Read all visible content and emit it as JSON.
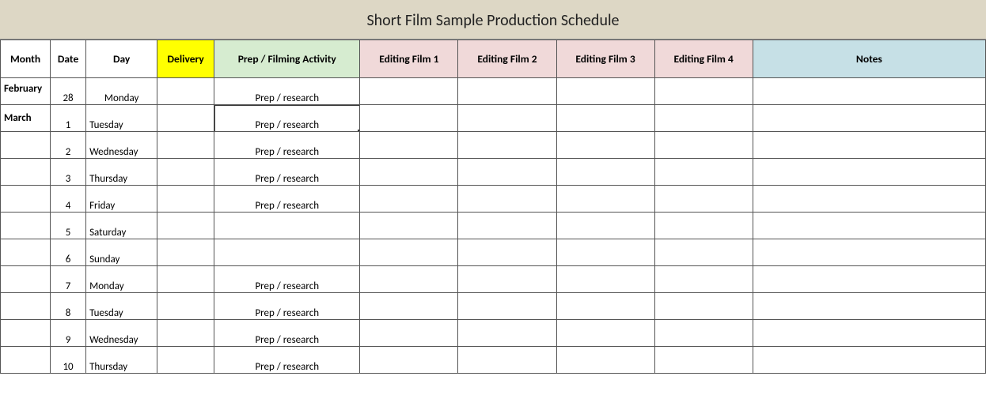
{
  "title": "Short Film Sample Production Schedule",
  "headers": {
    "month": "Month",
    "date": "Date",
    "day": "Day",
    "delivery": "Delivery",
    "activity": "Prep / Filming Activity",
    "edit1": "Editing Film 1",
    "edit2": "Editing Film 2",
    "edit3": "Editing Film 3",
    "edit4": "Editing Film 4",
    "notes": "Notes"
  },
  "rows": [
    {
      "month": "February",
      "date": "28",
      "day": "Monday",
      "delivery": "",
      "activity": "Prep / research",
      "e1": "",
      "e2": "",
      "e3": "",
      "e4": "",
      "notes": ""
    },
    {
      "month": "March",
      "date": "1",
      "day": "Tuesday",
      "delivery": "",
      "activity": "Prep / research",
      "e1": "",
      "e2": "",
      "e3": "",
      "e4": "",
      "notes": ""
    },
    {
      "month": "",
      "date": "2",
      "day": "Wednesday",
      "delivery": "",
      "activity": "Prep / research",
      "e1": "",
      "e2": "",
      "e3": "",
      "e4": "",
      "notes": ""
    },
    {
      "month": "",
      "date": "3",
      "day": "Thursday",
      "delivery": "",
      "activity": "Prep / research",
      "e1": "",
      "e2": "",
      "e3": "",
      "e4": "",
      "notes": ""
    },
    {
      "month": "",
      "date": "4",
      "day": "Friday",
      "delivery": "",
      "activity": "Prep / research",
      "e1": "",
      "e2": "",
      "e3": "",
      "e4": "",
      "notes": ""
    },
    {
      "month": "",
      "date": "5",
      "day": "Saturday",
      "delivery": "",
      "activity": "",
      "e1": "",
      "e2": "",
      "e3": "",
      "e4": "",
      "notes": ""
    },
    {
      "month": "",
      "date": "6",
      "day": "Sunday",
      "delivery": "",
      "activity": "",
      "e1": "",
      "e2": "",
      "e3": "",
      "e4": "",
      "notes": ""
    },
    {
      "month": "",
      "date": "7",
      "day": "Monday",
      "delivery": "",
      "activity": "Prep / research",
      "e1": "",
      "e2": "",
      "e3": "",
      "e4": "",
      "notes": ""
    },
    {
      "month": "",
      "date": "8",
      "day": "Tuesday",
      "delivery": "",
      "activity": "Prep / research",
      "e1": "",
      "e2": "",
      "e3": "",
      "e4": "",
      "notes": ""
    },
    {
      "month": "",
      "date": "9",
      "day": "Wednesday",
      "delivery": "",
      "activity": "Prep / research",
      "e1": "",
      "e2": "",
      "e3": "",
      "e4": "",
      "notes": ""
    },
    {
      "month": "",
      "date": "10",
      "day": "Thursday",
      "delivery": "",
      "activity": "Prep / research",
      "e1": "",
      "e2": "",
      "e3": "",
      "e4": "",
      "notes": ""
    }
  ],
  "selected_row_index": 1
}
